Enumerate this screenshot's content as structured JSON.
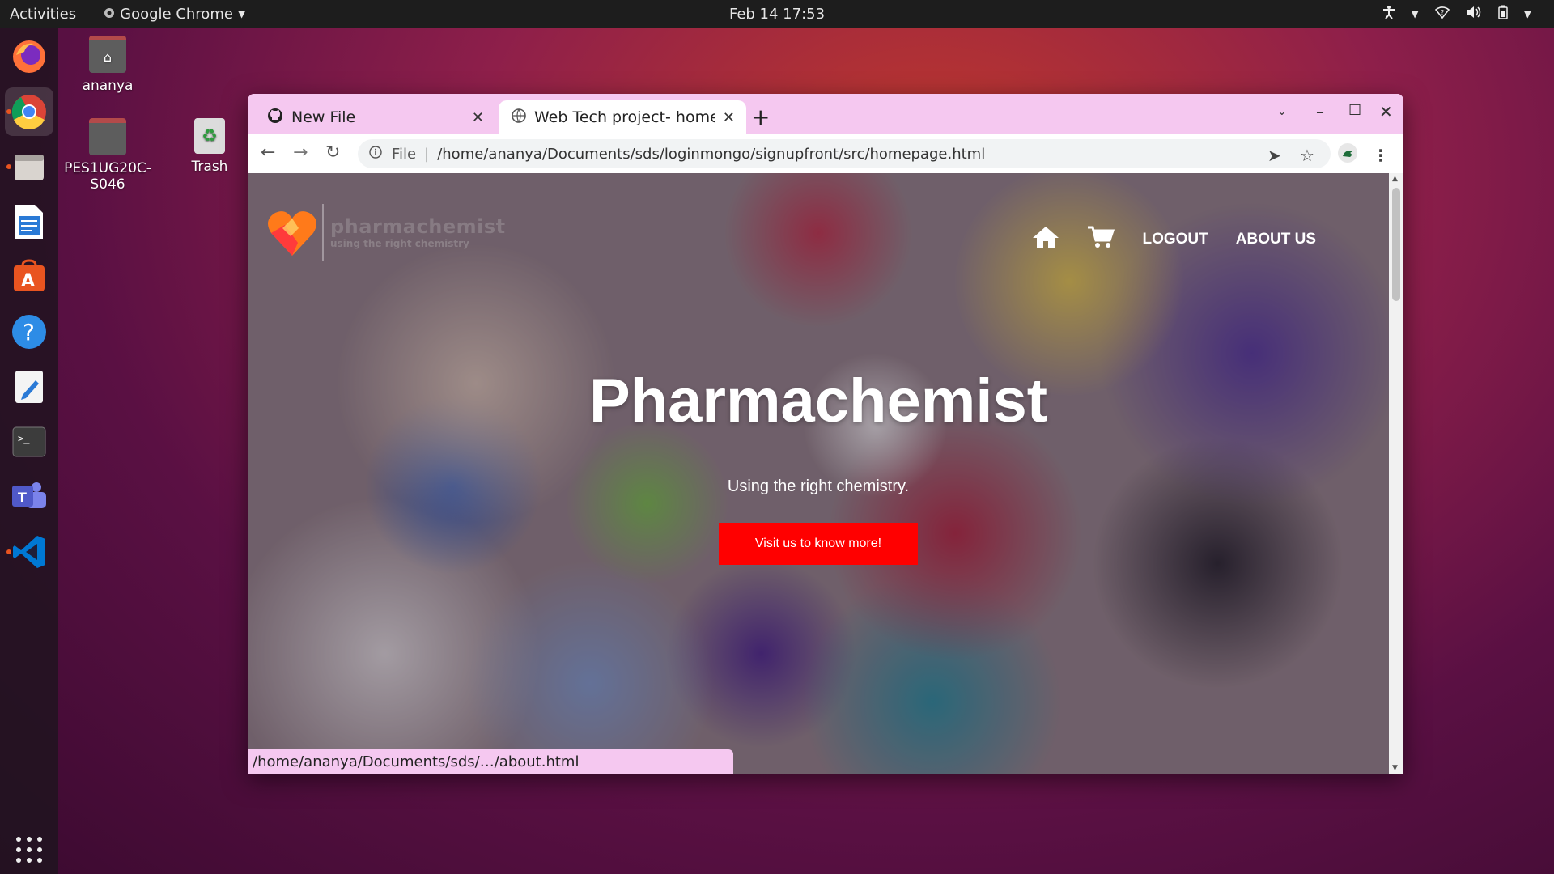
{
  "topbar": {
    "activities": "Activities",
    "app_name": "Google Chrome",
    "clock": "Feb 14  17:53"
  },
  "dock": {
    "items": [
      "firefox-icon",
      "chrome-icon",
      "files-icon",
      "writer-icon",
      "software-icon",
      "help-icon",
      "text-editor-icon",
      "terminal-icon",
      "teams-icon",
      "vscode-icon"
    ]
  },
  "desktop": {
    "icons": [
      {
        "label": "ananya"
      },
      {
        "label": "PES1UG20C-S046"
      },
      {
        "label": "Trash"
      }
    ]
  },
  "browser": {
    "tabs": [
      {
        "title": "New File"
      },
      {
        "title": "Web Tech project- homep"
      }
    ],
    "omnibox": {
      "scheme": "File",
      "url": "/home/ananya/Documents/sds/loginmongo/signupfront/src/homepage.html"
    },
    "status_url": "/home/ananya/Documents/sds/…/about.html"
  },
  "page": {
    "logo_name": "pharmachemist",
    "logo_tagline": "using the right chemistry",
    "nav": {
      "logout": "LOGOUT",
      "about": "ABOUT US"
    },
    "hero_title": "Pharmachemist",
    "hero_subtitle": "Using the right chemistry.",
    "cta_label": "Visit us to know more!"
  },
  "colors": {
    "cta": "#ff0000",
    "tabbar": "#f5c8f0"
  }
}
